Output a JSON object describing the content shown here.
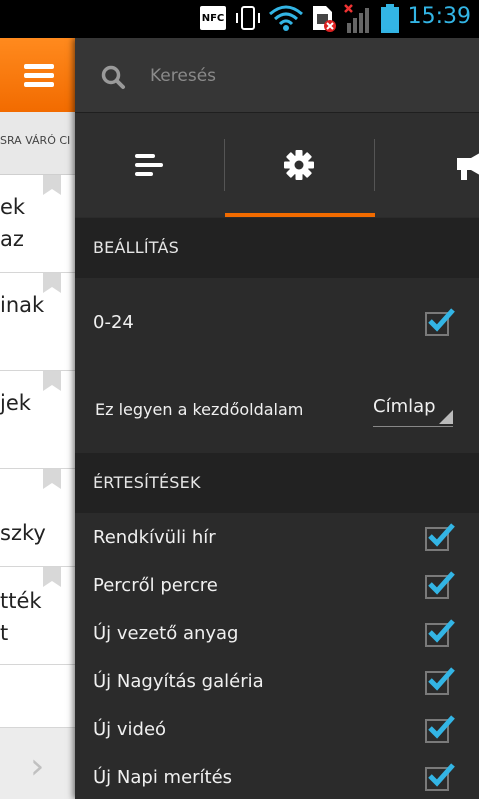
{
  "status_bar": {
    "nfc_label": "NFC",
    "time": "15:39",
    "accent": "#33b5e5",
    "icons": [
      "vibrate-icon",
      "wifi-icon",
      "sim-card-error-icon",
      "no-signal-icon",
      "battery-icon"
    ]
  },
  "left_pane": {
    "tab_label": "SRA VÁRÓ CI",
    "articles": [
      {
        "text": "ek\naz"
      },
      {
        "text": "inak"
      },
      {
        "text": "jek"
      },
      {
        "text": "szky"
      },
      {
        "text": "tték\nt"
      },
      {
        "text": ""
      }
    ]
  },
  "search": {
    "placeholder": "Keresés"
  },
  "tabs": {
    "items": [
      "list-icon",
      "gear-icon",
      "megaphone-icon"
    ],
    "active_index": 1,
    "accent": "#f26b00"
  },
  "settings": {
    "title": "BEÁLLÍTÁS",
    "always_on": {
      "label": "0-24",
      "checked": true
    },
    "homepage": {
      "label": "Ez legyen a kezdőoldalam",
      "value": "Címlap"
    }
  },
  "notifications": {
    "title": "ÉRTESÍTÉSEK",
    "items": [
      {
        "label": "Rendkívüli hír",
        "checked": true
      },
      {
        "label": "Percről percre",
        "checked": true
      },
      {
        "label": "Új vezető anyag",
        "checked": true
      },
      {
        "label": "Új Nagyítás galéria",
        "checked": true
      },
      {
        "label": "Új videó",
        "checked": true
      },
      {
        "label": "Új Napi merítés",
        "checked": true
      }
    ]
  }
}
